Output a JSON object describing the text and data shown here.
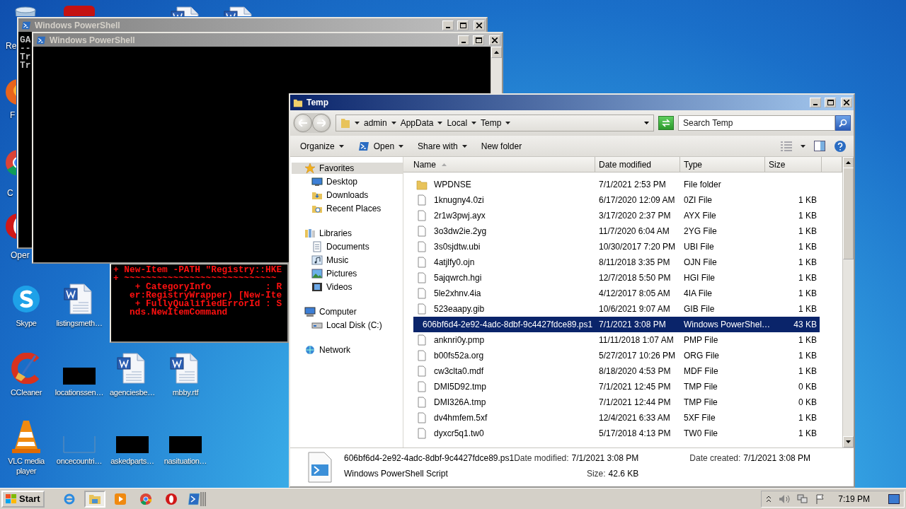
{
  "desktop_icons": [
    {
      "kind": "recycle",
      "label": "Re"
    },
    {
      "kind": "badge"
    },
    {
      "kind": "word"
    },
    {
      "kind": "word"
    },
    {
      "kind": "firefox",
      "label": "F"
    },
    {
      "kind": "chrome",
      "label": "C"
    },
    {
      "kind": "opera",
      "label": "Oper"
    },
    {
      "kind": "skype",
      "label": "Skype"
    },
    {
      "kind": "word",
      "label": "listingsmeth…"
    },
    {
      "kind": "ccleaner",
      "label": "CCleaner"
    },
    {
      "kind": "black",
      "label": "locationssen…"
    },
    {
      "kind": "word",
      "label": "agenciesbe…"
    },
    {
      "kind": "word",
      "label": "mbby.rtf"
    },
    {
      "kind": "vlc",
      "label": "VLC media player"
    },
    {
      "kind": "blank",
      "label": "oncecountri…"
    },
    {
      "kind": "black",
      "label": "askedparts…"
    },
    {
      "kind": "black",
      "label": "nasituation…"
    }
  ],
  "error_console": {
    "lines": [
      "+ New-Item -PATH \"Registry::HKE",
      "+ ~~~~~~~~~~~~~~~~~~~~~~~~~~~~",
      "    + CategoryInfo          : R",
      "   er:RegistryWrapper) [New-Ite",
      "    + FullyQualifiedErrorId : S",
      "   nds.NewItemCommand"
    ]
  },
  "console_windows": [
    {
      "title": "Windows PowerShell",
      "active": false,
      "lines": [
        "GA",
        "--",
        "Tr",
        "Tr"
      ]
    },
    {
      "title": "Windows PowerShell",
      "active": false
    }
  ],
  "explorer": {
    "title": "Temp",
    "active": true,
    "breadcrumbs": [
      "admin",
      "AppData",
      "Local",
      "Temp"
    ],
    "search": {
      "placeholder": "Search Temp"
    },
    "toolbar": [
      {
        "label": "Organize",
        "kind": "menu"
      },
      {
        "label": "Open",
        "kind": "open"
      },
      {
        "label": "Share with",
        "kind": "menu"
      },
      {
        "label": "New folder",
        "kind": "plain"
      }
    ],
    "nav": [
      {
        "label": "Favorites",
        "kind": "star",
        "selected": true,
        "children": [
          {
            "label": "Desktop",
            "kind": "desktop",
            "selected": false
          },
          {
            "label": "Downloads",
            "kind": "downloads",
            "selected": false
          },
          {
            "label": "Recent Places",
            "kind": "recent",
            "selected": false
          }
        ]
      },
      {
        "label": "Libraries",
        "kind": "library",
        "selected": false,
        "children": [
          {
            "label": "Documents",
            "kind": "documents",
            "selected": false
          },
          {
            "label": "Music",
            "kind": "music",
            "selected": false
          },
          {
            "label": "Pictures",
            "kind": "pictures",
            "selected": false
          },
          {
            "label": "Videos",
            "kind": "videos",
            "selected": false
          }
        ]
      },
      {
        "label": "Computer",
        "kind": "computer",
        "selected": false,
        "children": [
          {
            "label": "Local Disk (C:)",
            "kind": "disk",
            "selected": false
          }
        ]
      },
      {
        "label": "Network",
        "kind": "network",
        "selected": false
      }
    ],
    "columns": [
      "Name",
      "Date modified",
      "Type",
      "Size"
    ],
    "rows": [
      {
        "name": "WPDNSE",
        "date": "7/1/2021 2:53 PM",
        "type": "File folder",
        "size": "",
        "kind": "folder",
        "selected": false
      },
      {
        "name": "1knugny4.0zi",
        "date": "6/17/2020 12:09 AM",
        "type": "0ZI File",
        "size": "1 KB",
        "kind": "file",
        "selected": false
      },
      {
        "name": "2r1w3pwj.ayx",
        "date": "3/17/2020 2:37 PM",
        "type": "AYX File",
        "size": "1 KB",
        "kind": "file",
        "selected": false
      },
      {
        "name": "3o3dw2ie.2yg",
        "date": "11/7/2020 6:04 AM",
        "type": "2YG File",
        "size": "1 KB",
        "kind": "file",
        "selected": false
      },
      {
        "name": "3s0sjdtw.ubi",
        "date": "10/30/2017 7:20 PM",
        "type": "UBI File",
        "size": "1 KB",
        "kind": "file",
        "selected": false
      },
      {
        "name": "4atjlfy0.ojn",
        "date": "8/11/2018 3:35 PM",
        "type": "OJN File",
        "size": "1 KB",
        "kind": "file",
        "selected": false
      },
      {
        "name": "5ajqwrch.hgi",
        "date": "12/7/2018 5:50 PM",
        "type": "HGI File",
        "size": "1 KB",
        "kind": "file",
        "selected": false
      },
      {
        "name": "5le2xhnv.4ia",
        "date": "4/12/2017 8:05 AM",
        "type": "4IA File",
        "size": "1 KB",
        "kind": "file",
        "selected": false
      },
      {
        "name": "523eaapy.gib",
        "date": "10/6/2021 9:07 AM",
        "type": "GIB File",
        "size": "1 KB",
        "kind": "file",
        "selected": false
      },
      {
        "name": "606bf6d4-2e92-4adc-8dbf-9c4427fdce89.ps1",
        "date": "7/1/2021 3:08 PM",
        "type": "Windows PowerShel…",
        "size": "43 KB",
        "kind": "script",
        "selected": true
      },
      {
        "name": "anknri0y.pmp",
        "date": "11/11/2018 1:07 AM",
        "type": "PMP File",
        "size": "1 KB",
        "kind": "file",
        "selected": false
      },
      {
        "name": "b00fs52a.org",
        "date": "5/27/2017 10:26 PM",
        "type": "ORG File",
        "size": "1 KB",
        "kind": "file",
        "selected": false
      },
      {
        "name": "cw3clta0.mdf",
        "date": "8/18/2020 4:53 PM",
        "type": "MDF File",
        "size": "1 KB",
        "kind": "file",
        "selected": false
      },
      {
        "name": "DMI5D92.tmp",
        "date": "7/1/2021 12:45 PM",
        "type": "TMP File",
        "size": "0 KB",
        "kind": "file",
        "selected": false
      },
      {
        "name": "DMI326A.tmp",
        "date": "7/1/2021 12:44 PM",
        "type": "TMP File",
        "size": "0 KB",
        "kind": "file",
        "selected": false
      },
      {
        "name": "dv4hmfem.5xf",
        "date": "12/4/2021 6:33 AM",
        "type": "5XF File",
        "size": "1 KB",
        "kind": "file",
        "selected": false
      },
      {
        "name": "dyxcr5q1.tw0",
        "date": "5/17/2018 4:13 PM",
        "type": "TW0 File",
        "size": "1 KB",
        "kind": "file",
        "selected": false
      }
    ],
    "details": {
      "name": "606bf6d4-2e92-4adc-8dbf-9c4427fdce89.ps1",
      "type": "Windows PowerShell Script",
      "fields": [
        {
          "label": "Date modified:",
          "value": "7/1/2021 3:08 PM"
        },
        {
          "label": "Size:",
          "value": "42.6 KB"
        },
        {
          "label": "Date created:",
          "value": "7/1/2021 3:08 PM"
        }
      ]
    }
  },
  "taskbar": {
    "start": "Start",
    "apps": [
      {
        "kind": "ie",
        "selected": false
      },
      {
        "kind": "explorer",
        "selected": true
      },
      {
        "kind": "media",
        "selected": false
      },
      {
        "kind": "chrome",
        "selected": false
      },
      {
        "kind": "opera",
        "selected": false
      },
      {
        "kind": "powershell",
        "selected": false
      }
    ],
    "time": "7:19 PM"
  }
}
